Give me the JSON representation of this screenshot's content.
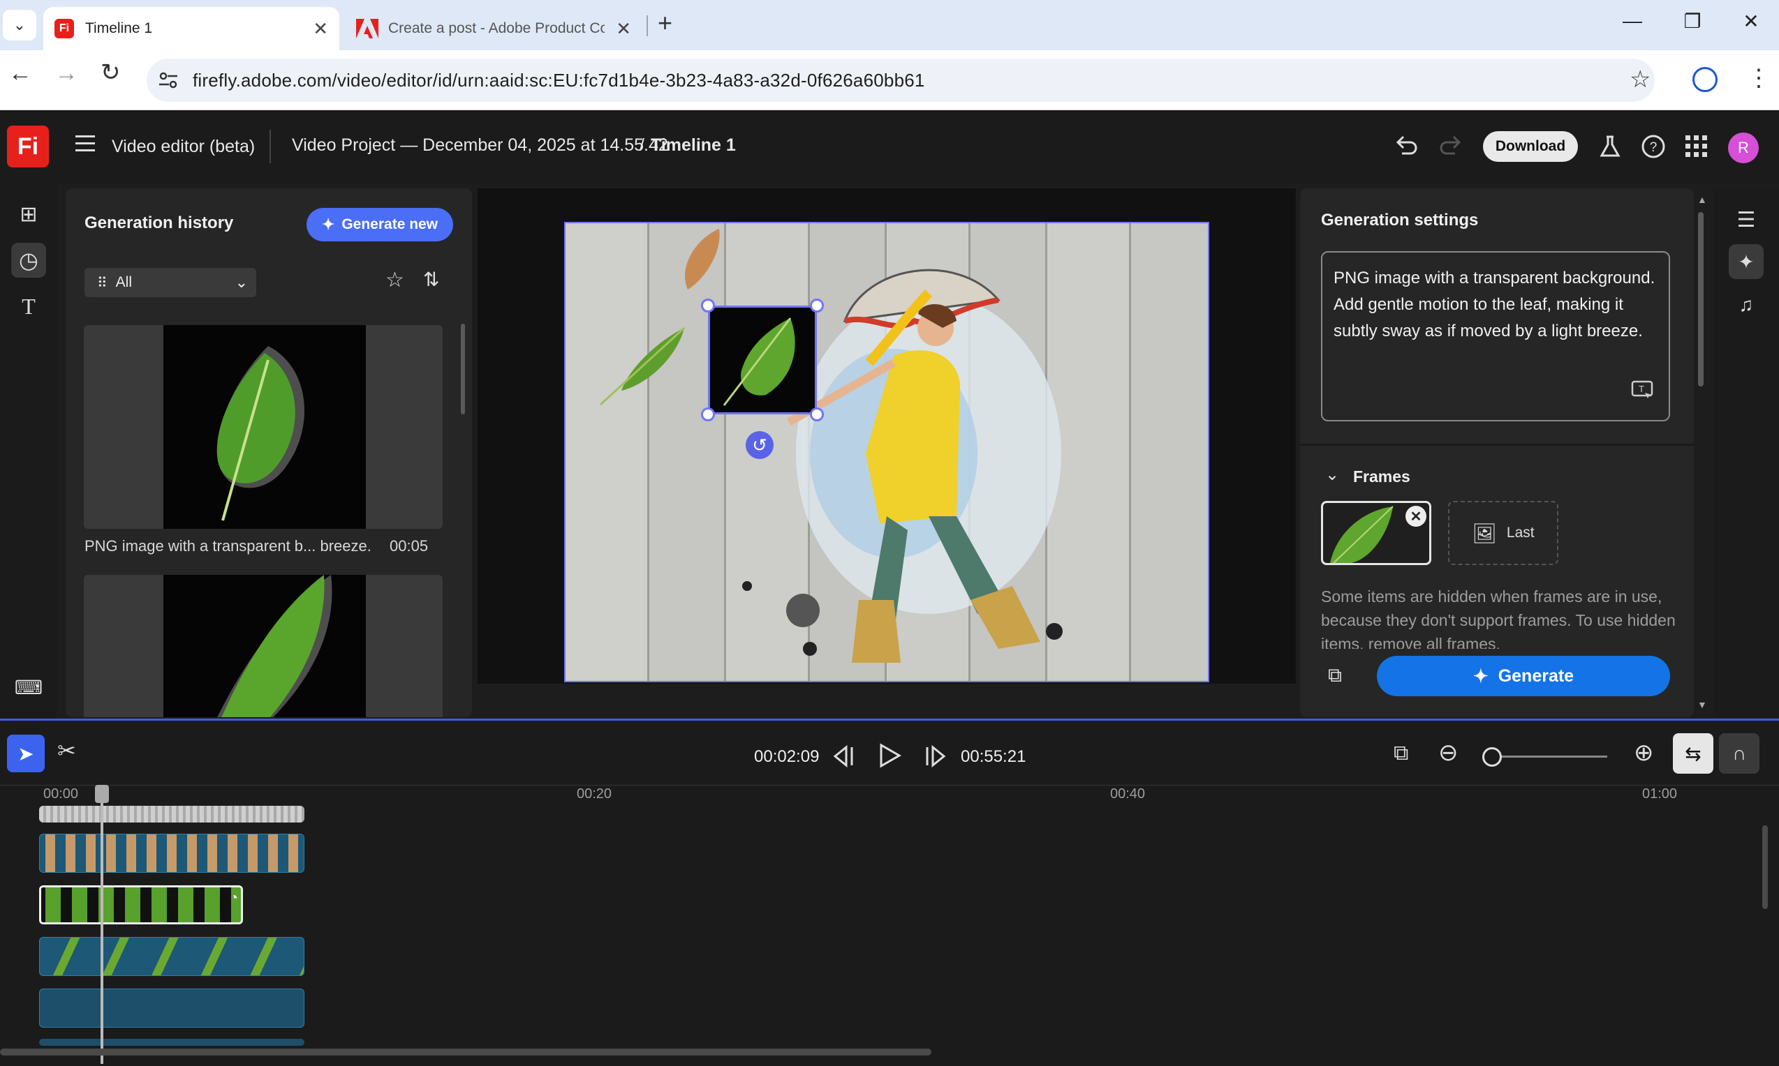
{
  "browser": {
    "tabs": [
      {
        "title": "Timeline 1",
        "active": true
      },
      {
        "title": "Create a post - Adobe Product Co",
        "active": false
      }
    ],
    "url": "firefly.adobe.com/video/editor/id/urn:aaid:sc:EU:fc7d1b4e-3b23-4a83-a32d-0f626a60bb61",
    "new_tab_symbol": "+"
  },
  "app": {
    "logo_text": "Fi",
    "menu_label": "Video editor (beta)",
    "project_title": "Video Project — December 04, 2025 at 14.55.42",
    "separator": "/",
    "timeline_name": "Timeline 1",
    "download_label": "Download",
    "avatar_initial": "R"
  },
  "history": {
    "title": "Generation history",
    "generate_new_label": "Generate new",
    "filter_value": "All",
    "items": [
      {
        "caption": "PNG image with a transparent b... breeze.",
        "duration": "00:05"
      }
    ]
  },
  "settings": {
    "title": "Generation settings",
    "prompt": "PNG image with a transparent background. Add gentle motion to the leaf, making it subtly sway as if moved by a light breeze.",
    "frames_label": "Frames",
    "last_frame_label": "Last",
    "note": "Some items are hidden when frames are in use, because they don't support frames. To use hidden items, remove all frames.",
    "generate_label": "Generate"
  },
  "timeline": {
    "current_time": "00:02:09",
    "total_time": "00:55:21",
    "ruler_labels": [
      "00:00",
      "00:20",
      "00:40",
      "01:00"
    ],
    "zoom_level": 0.05
  },
  "colors": {
    "accent": "#4a6ef5",
    "generate": "#1473e6",
    "brand": "#e8201c",
    "selection": "#6f76f7"
  },
  "icons": [
    "menu-icon",
    "undo-icon",
    "redo-icon",
    "flask-icon",
    "help-icon",
    "apps-grid-icon",
    "star-icon",
    "sort-icon",
    "play-icon",
    "scissors-icon"
  ]
}
